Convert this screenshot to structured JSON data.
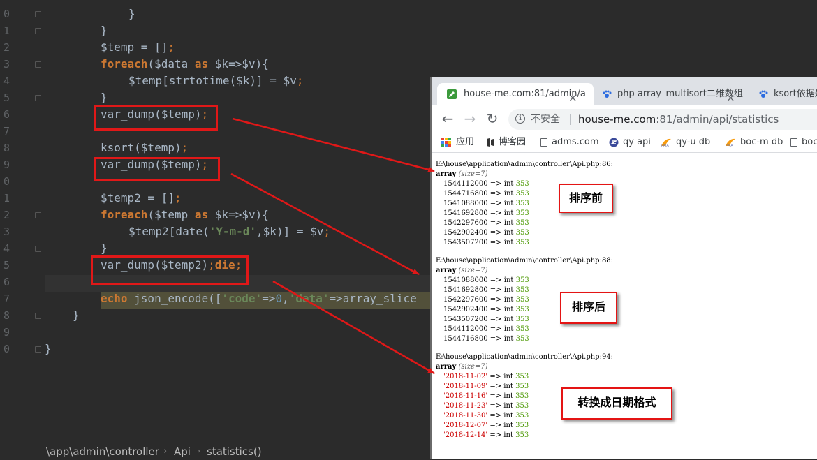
{
  "editor": {
    "line_numbers": [
      "0",
      "1",
      "2",
      "3",
      "4",
      "5",
      "6",
      "7",
      "8",
      "9",
      "0",
      "1",
      "2",
      "3",
      "4",
      "5",
      "6",
      "7",
      "8",
      "9",
      "0"
    ],
    "lines": [
      {
        "indent": "",
        "text": "}"
      },
      {
        "indent": "",
        "text": "}"
      },
      {
        "indent": "",
        "text": "$temp = [];"
      },
      {
        "indent": "",
        "text": "foreach($data as $k=>$v){"
      },
      {
        "indent": "",
        "text": "$temp[strtotime($k)] = $v;"
      },
      {
        "indent": "",
        "text": "}"
      },
      {
        "indent": "",
        "text": "var_dump($temp);"
      },
      {
        "indent": "",
        "text": ""
      },
      {
        "indent": "",
        "text": "ksort($temp);"
      },
      {
        "indent": "",
        "text": "var_dump($temp);"
      },
      {
        "indent": "",
        "text": ""
      },
      {
        "indent": "",
        "text": "$temp2 = [];"
      },
      {
        "indent": "",
        "text": "foreach($temp as $k=>$v){"
      },
      {
        "indent": "",
        "text": "$temp2[date('Y-m-d',$k)] = $v;"
      },
      {
        "indent": "",
        "text": "}"
      },
      {
        "indent": "",
        "text": "var_dump($temp2);die;"
      },
      {
        "indent": "",
        "text": ""
      },
      {
        "indent": "",
        "text": "echo json_encode(['code'=>0,'data'=>array_slice"
      },
      {
        "indent": "",
        "text": "}"
      },
      {
        "indent": "",
        "text": ""
      },
      {
        "indent": "",
        "text": "}"
      }
    ],
    "breadcrumb": {
      "path": "\\app\\admin\\controller",
      "sep1": "›",
      "class": "Api",
      "sep2": "›",
      "method": "statistics()"
    }
  },
  "browser": {
    "tabs": [
      {
        "title": "house-me.com:81/admin/a",
        "close": "×"
      },
      {
        "title": "php array_multisort二维数组",
        "close": "×"
      },
      {
        "title": "ksort依据是",
        "close": ""
      }
    ],
    "nav": {
      "back": "←",
      "forward": "→",
      "reload": "↻"
    },
    "address": {
      "security": "不安全",
      "host": "house-me.com",
      "rest": ":81/admin/api/statistics"
    },
    "bookmarks": [
      "应用",
      "博客园",
      "adms.com",
      "qy api",
      "qy-u db",
      "boc-m db",
      "boc"
    ],
    "dumps": [
      {
        "path": "E:\\house\\application\\admin\\controller\\Api.php:86:",
        "array_label": "array",
        "size": "(size=7)",
        "items": [
          {
            "key": "1544112000",
            "type": "int",
            "val": "353"
          },
          {
            "key": "1544716800",
            "type": "int",
            "val": "353"
          },
          {
            "key": "1541088000",
            "type": "int",
            "val": "353"
          },
          {
            "key": "1541692800",
            "type": "int",
            "val": "353"
          },
          {
            "key": "1542297600",
            "type": "int",
            "val": "353"
          },
          {
            "key": "1542902400",
            "type": "int",
            "val": "353"
          },
          {
            "key": "1543507200",
            "type": "int",
            "val": "353"
          }
        ]
      },
      {
        "path": "E:\\house\\application\\admin\\controller\\Api.php:88:",
        "array_label": "array",
        "size": "(size=7)",
        "items": [
          {
            "key": "1541088000",
            "type": "int",
            "val": "353"
          },
          {
            "key": "1541692800",
            "type": "int",
            "val": "353"
          },
          {
            "key": "1542297600",
            "type": "int",
            "val": "353"
          },
          {
            "key": "1542902400",
            "type": "int",
            "val": "353"
          },
          {
            "key": "1543507200",
            "type": "int",
            "val": "353"
          },
          {
            "key": "1544112000",
            "type": "int",
            "val": "353"
          },
          {
            "key": "1544716800",
            "type": "int",
            "val": "353"
          }
        ]
      },
      {
        "path": "E:\\house\\application\\admin\\controller\\Api.php:94:",
        "array_label": "array",
        "size": "(size=7)",
        "items": [
          {
            "key": "'2018-11-02'",
            "type": "int",
            "val": "353"
          },
          {
            "key": "'2018-11-09'",
            "type": "int",
            "val": "353"
          },
          {
            "key": "'2018-11-16'",
            "type": "int",
            "val": "353"
          },
          {
            "key": "'2018-11-23'",
            "type": "int",
            "val": "353"
          },
          {
            "key": "'2018-11-30'",
            "type": "int",
            "val": "353"
          },
          {
            "key": "'2018-12-07'",
            "type": "int",
            "val": "353"
          },
          {
            "key": "'2018-12-14'",
            "type": "int",
            "val": "353"
          }
        ]
      }
    ]
  },
  "annotations": {
    "label_before": "排序前",
    "label_after": "排序后",
    "label_date": "转换成日期格式",
    "arrow_color": "#e01818"
  }
}
